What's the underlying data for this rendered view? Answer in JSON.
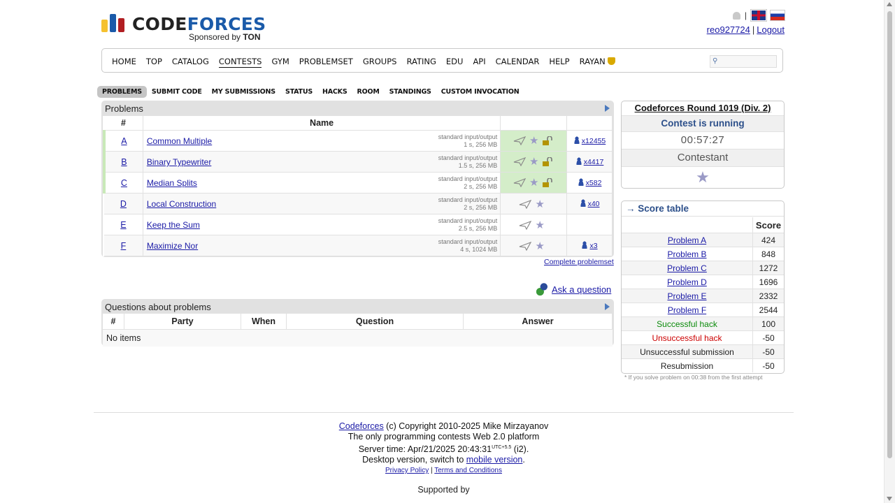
{
  "header": {
    "logo_word_a": "CODE",
    "logo_word_b": "FORCES",
    "sponsor_prefix": "Sponsored by",
    "sponsor_name": "TON",
    "username": "reo927724",
    "logout": "Logout"
  },
  "menu": [
    "HOME",
    "TOP",
    "CATALOG",
    "CONTESTS",
    "GYM",
    "PROBLEMSET",
    "GROUPS",
    "RATING",
    "EDU",
    "API",
    "CALENDAR",
    "HELP",
    "RAYAN"
  ],
  "menu_active": "CONTESTS",
  "submenu": [
    "PROBLEMS",
    "SUBMIT CODE",
    "MY SUBMISSIONS",
    "STATUS",
    "HACKS",
    "ROOM",
    "STANDINGS",
    "CUSTOM INVOCATION"
  ],
  "problems": {
    "title": "Problems",
    "col_num": "#",
    "col_name": "Name",
    "rows": [
      {
        "idx": "A",
        "name": "Common Multiple",
        "io": "standard input/output",
        "limits": "1 s, 256 MB",
        "solved": "x12455"
      },
      {
        "idx": "B",
        "name": "Binary Typewriter",
        "io": "standard input/output",
        "limits": "1.5 s, 256 MB",
        "solved": "x4417"
      },
      {
        "idx": "C",
        "name": "Median Splits",
        "io": "standard input/output",
        "limits": "2 s, 256 MB",
        "solved": "x582"
      },
      {
        "idx": "D",
        "name": "Local Construction",
        "io": "standard input/output",
        "limits": "2 s, 256 MB",
        "solved": "x40"
      },
      {
        "idx": "E",
        "name": "Keep the Sum",
        "io": "standard input/output",
        "limits": "2.5 s, 256 MB",
        "solved": ""
      },
      {
        "idx": "F",
        "name": "Maximize Nor",
        "io": "standard input/output",
        "limits": "4 s, 1024 MB",
        "solved": "x3"
      }
    ],
    "complete_link": "Complete problemset"
  },
  "ask_question": "Ask a question",
  "questions": {
    "title": "Questions about problems",
    "cols": [
      "#",
      "Party",
      "When",
      "Question",
      "Answer"
    ],
    "empty": "No items"
  },
  "round": {
    "name": "Codeforces Round 1019 (Div. 2)",
    "status": "Contest is running",
    "timer": "00:57:27",
    "role": "Contestant"
  },
  "score": {
    "title": "→ Score table",
    "col_score": "Score",
    "rows": [
      {
        "label": "Problem A",
        "value": "424",
        "kind": "link"
      },
      {
        "label": "Problem B",
        "value": "848",
        "kind": "link"
      },
      {
        "label": "Problem C",
        "value": "1272",
        "kind": "link"
      },
      {
        "label": "Problem D",
        "value": "1696",
        "kind": "link"
      },
      {
        "label": "Problem E",
        "value": "2332",
        "kind": "link"
      },
      {
        "label": "Problem F",
        "value": "2544",
        "kind": "link"
      },
      {
        "label": "Successful hack",
        "value": "100",
        "kind": "green"
      },
      {
        "label": "Unsuccessful hack",
        "value": "-50",
        "kind": "red"
      },
      {
        "label": "Unsuccessful submission",
        "value": "-50",
        "kind": "plain"
      },
      {
        "label": "Resubmission",
        "value": "-50",
        "kind": "plain"
      }
    ],
    "note": "* If you solve problem on 00:38 from the first attempt"
  },
  "footer": {
    "cf_link": "Codeforces",
    "copyright": " (c) Copyright 2010-2025 Mike Mirzayanov",
    "tagline": "The only programming contests Web 2.0 platform",
    "server_time_prefix": "Server time: Apr/21/2025 20:43:31",
    "utc": "UTC+5.5",
    "server_suffix": " (i2).",
    "desktop_prefix": "Desktop version, switch to ",
    "mobile_link": "mobile version",
    "desktop_suffix": ".",
    "privacy": "Privacy Policy",
    "terms": "Terms and Conditions",
    "supported": "Supported by"
  }
}
